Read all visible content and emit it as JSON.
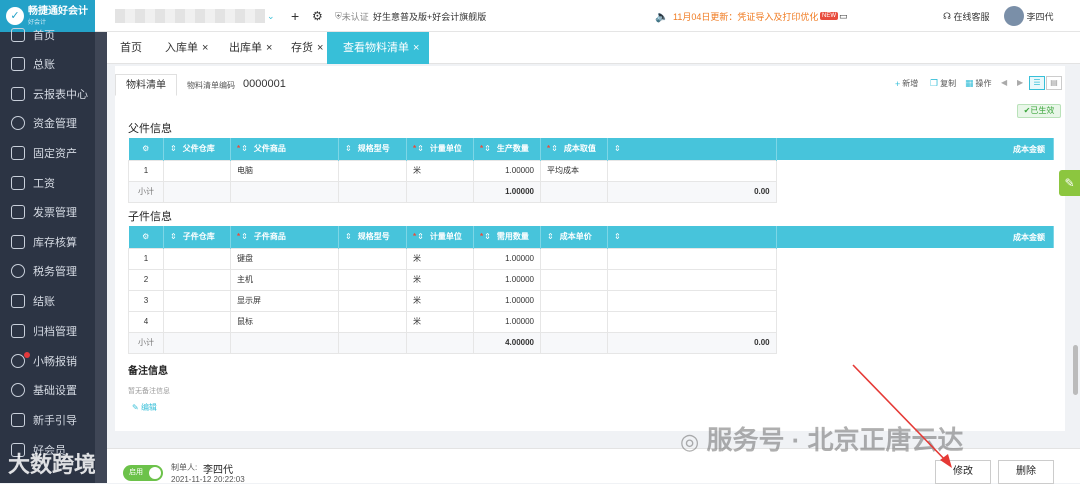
{
  "app": {
    "logo_text": "畅捷通好会计",
    "logo_sub": "好会计"
  },
  "sidebar": {
    "items": [
      {
        "label": "首页"
      },
      {
        "label": "总账"
      },
      {
        "label": "云报表中心"
      },
      {
        "label": "资金管理"
      },
      {
        "label": "固定资产"
      },
      {
        "label": "工资"
      },
      {
        "label": "发票管理"
      },
      {
        "label": "库存核算"
      },
      {
        "label": "税务管理"
      },
      {
        "label": "结账"
      },
      {
        "label": "归档管理"
      },
      {
        "label": "小畅报销"
      },
      {
        "label": "基础设置"
      },
      {
        "label": "新手引导"
      },
      {
        "label": "好会员"
      }
    ]
  },
  "topbar": {
    "plus": "+",
    "cert": "未认证",
    "promo": "好生意普及版+好会计旗舰版",
    "notice": "11月04日更新：凭证导入及打印优化",
    "new_badge": "NEW",
    "service": "在线客服",
    "user": "李四代"
  },
  "tabs": [
    {
      "label": "首页",
      "closable": false
    },
    {
      "label": "入库单",
      "closable": true
    },
    {
      "label": "出库单",
      "closable": true
    },
    {
      "label": "存货",
      "closable": true
    },
    {
      "label": "查看物料清单",
      "closable": true,
      "active": true
    }
  ],
  "page": {
    "subtab": "物料清单",
    "code_label": "物料清单编码",
    "code_value": "0000001",
    "toolbar": {
      "add": "新增",
      "copy": "复制",
      "ops": "操作"
    },
    "status": "已生效"
  },
  "parent": {
    "title": "父件信息",
    "headers": [
      "父件仓库",
      "父件商品",
      "规格型号",
      "计量单位",
      "生产数量",
      "成本取值",
      "",
      "成本金额"
    ],
    "rows": [
      {
        "no": "1",
        "warehouse": "",
        "product": "电脑",
        "spec": "",
        "unit": "米",
        "qty": "1.00000",
        "cost_method": "平均成本",
        "amount": ""
      }
    ],
    "subtotal_label": "小计",
    "subtotal_qty": "1.00000",
    "subtotal_amount": "0.00"
  },
  "child": {
    "title": "子件信息",
    "headers": [
      "子件仓库",
      "子件商品",
      "规格型号",
      "计量单位",
      "需用数量",
      "成本单价",
      "",
      "成本金额"
    ],
    "rows": [
      {
        "no": "1",
        "warehouse": "",
        "product": "键盘",
        "spec": "",
        "unit": "米",
        "qty": "1.00000",
        "price": "",
        "amount": ""
      },
      {
        "no": "2",
        "warehouse": "",
        "product": "主机",
        "spec": "",
        "unit": "米",
        "qty": "1.00000",
        "price": "",
        "amount": ""
      },
      {
        "no": "3",
        "warehouse": "",
        "product": "显示屏",
        "spec": "",
        "unit": "米",
        "qty": "1.00000",
        "price": "",
        "amount": ""
      },
      {
        "no": "4",
        "warehouse": "",
        "product": "鼠标",
        "spec": "",
        "unit": "米",
        "qty": "1.00000",
        "price": "",
        "amount": ""
      }
    ],
    "subtotal_label": "小计",
    "subtotal_qty": "4.00000",
    "subtotal_amount": "0.00"
  },
  "remark": {
    "title": "备注信息",
    "empty": "暂无备注信息",
    "edit": "编辑"
  },
  "footer": {
    "toggle": "启用",
    "creator_label": "制单人:",
    "creator": "李四代",
    "created_at": "2021-11-12 20:22:03",
    "modify": "修改",
    "delete": "删除"
  },
  "watermark": "服务号 · 北京正唐云达",
  "watermark2": "大数跨境",
  "colors": {
    "accent": "#37bfd8",
    "header": "#47c4db",
    "sidebar": "#2c3444",
    "status_green": "#3aa53a"
  }
}
